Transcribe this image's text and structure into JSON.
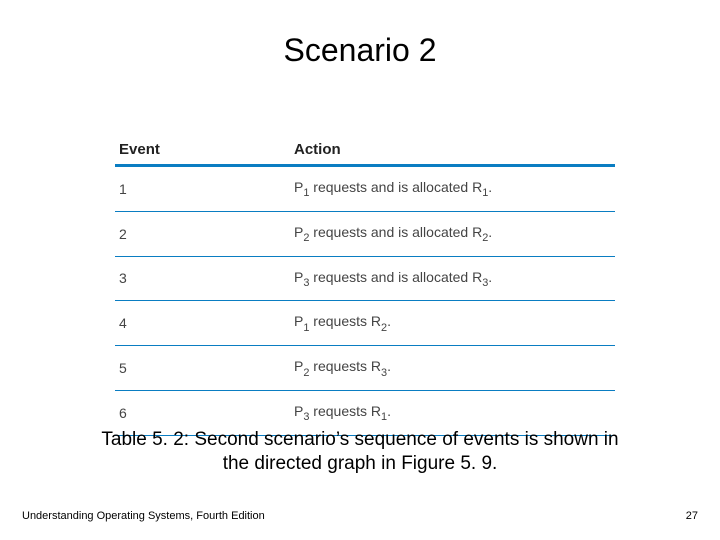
{
  "title": "Scenario 2",
  "table": {
    "headers": [
      "Event",
      "Action"
    ],
    "rows": [
      {
        "event": "1",
        "action_html": "P<span class=\"sub\">1</span> requests and is allocated R<span class=\"sub\">1</span>."
      },
      {
        "event": "2",
        "action_html": "P<span class=\"sub\">2</span> requests and is allocated R<span class=\"sub\">2</span>."
      },
      {
        "event": "3",
        "action_html": "P<span class=\"sub\">3</span> requests and is allocated R<span class=\"sub\">3</span>."
      },
      {
        "event": "4",
        "action_html": "P<span class=\"sub\">1</span> requests R<span class=\"sub\">2</span>."
      },
      {
        "event": "5",
        "action_html": "P<span class=\"sub\">2</span> requests R<span class=\"sub\">3</span>."
      },
      {
        "event": "6",
        "action_html": "P<span class=\"sub\">3</span> requests R<span class=\"sub\">1</span>."
      }
    ]
  },
  "caption": "Table 5. 2: Second scenario’s sequence of events is shown in the directed graph in Figure 5. 9.",
  "footer_left": "Understanding Operating Systems, Fourth Edition",
  "footer_right": "27",
  "chart_data": {
    "type": "table",
    "columns": [
      "Event",
      "Action"
    ],
    "rows": [
      [
        "1",
        "P1 requests and is allocated R1."
      ],
      [
        "2",
        "P2 requests and is allocated R2."
      ],
      [
        "3",
        "P3 requests and is allocated R3."
      ],
      [
        "4",
        "P1 requests R2."
      ],
      [
        "5",
        "P2 requests R3."
      ],
      [
        "6",
        "P3 requests R1."
      ]
    ]
  }
}
